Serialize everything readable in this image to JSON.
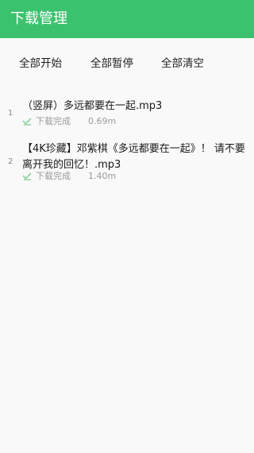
{
  "header": {
    "title": "下载管理"
  },
  "toolbar": {
    "start_all": "全部开始",
    "pause_all": "全部暂停",
    "clear_all": "全部清空"
  },
  "downloads": [
    {
      "index": "1",
      "name": "（竖屏）多远都要在一起.mp3",
      "status": "下载完成",
      "size": "0.69m",
      "status_icon": "download-complete-icon"
    },
    {
      "index": "2",
      "name": "【4K珍藏】邓紫棋《多远都要在一起》！ 请不要离开我的回忆！.mp3",
      "status": "下载完成",
      "size": "1.40m",
      "status_icon": "download-complete-icon"
    }
  ],
  "colors": {
    "accent": "#3bc26f",
    "status_icon": "#8fd19f"
  }
}
